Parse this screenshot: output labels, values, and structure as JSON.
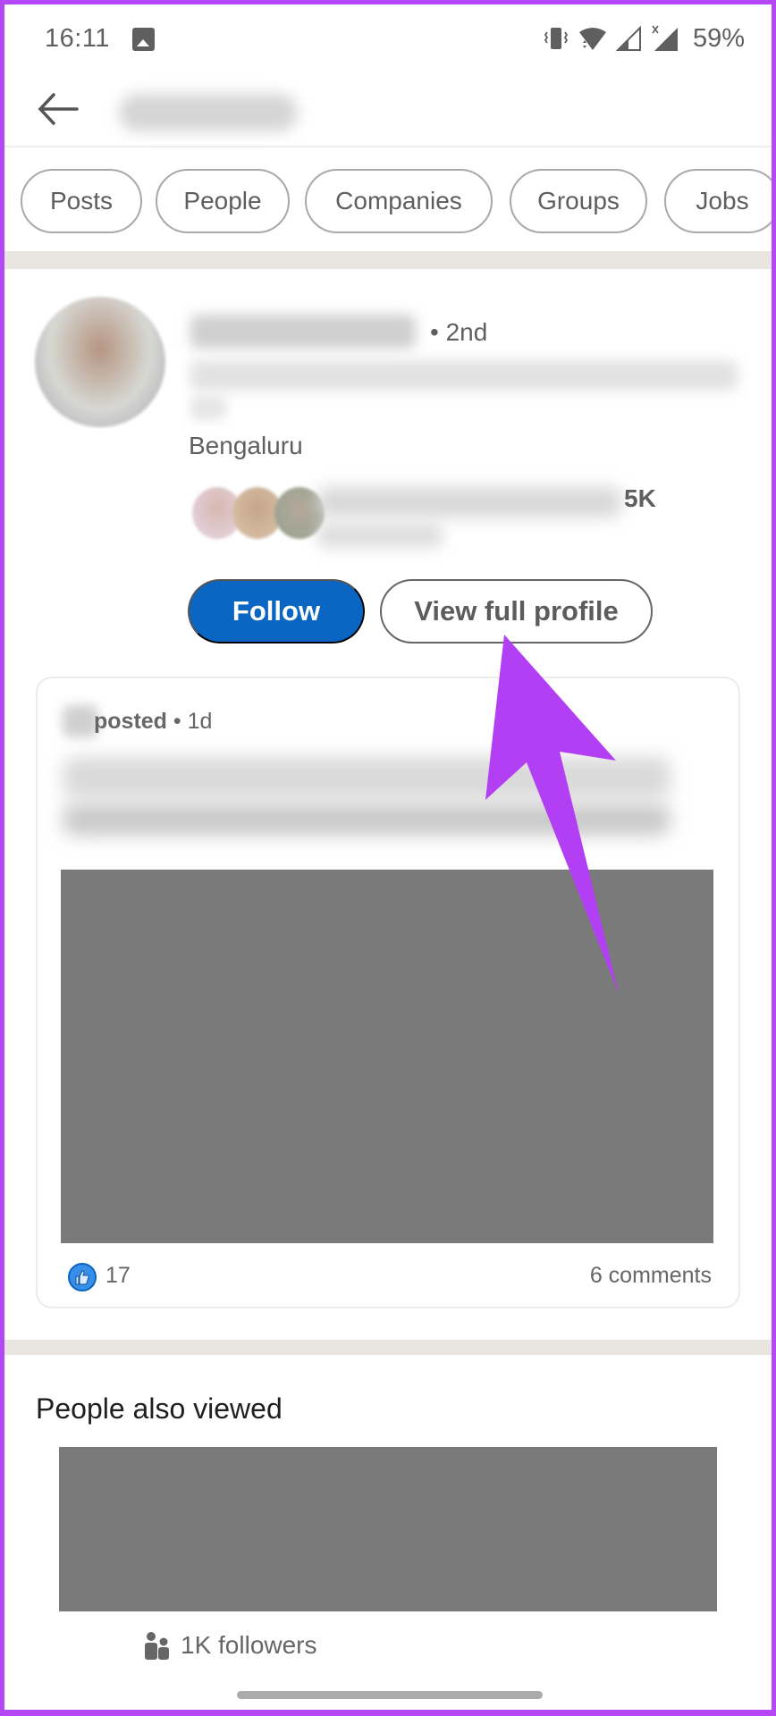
{
  "status_bar": {
    "time": "16:11",
    "notification_icon": "gallery-icon",
    "icons": [
      "vibrate-icon",
      "wifi-icon",
      "signal-icon",
      "signal-no-data-icon"
    ],
    "battery": "59%"
  },
  "header": {
    "back_icon": "arrow-left-icon",
    "search_query": ""
  },
  "filters": [
    {
      "label": "Posts"
    },
    {
      "label": "People"
    },
    {
      "label": "Companies"
    },
    {
      "label": "Groups"
    },
    {
      "label": "Jobs"
    }
  ],
  "profile": {
    "name": "",
    "degree": "• 2nd",
    "headline": "",
    "location": "Bengaluru",
    "mutual_count": "5K",
    "follow_label": "Follow",
    "view_profile_label": "View full profile"
  },
  "post": {
    "posted_label": "posted",
    "time": "• 1d",
    "likes": "17",
    "comments": "6 comments"
  },
  "people_also_viewed": {
    "title": "People also viewed",
    "followers": "1K followers"
  },
  "annotation": {
    "arrow_color": "#b33ff5",
    "target": "View full profile"
  },
  "colors": {
    "brand_blue": "#0a66c2",
    "frame_purple": "#b548f6",
    "placeholder_gray": "#7a7a7a"
  }
}
